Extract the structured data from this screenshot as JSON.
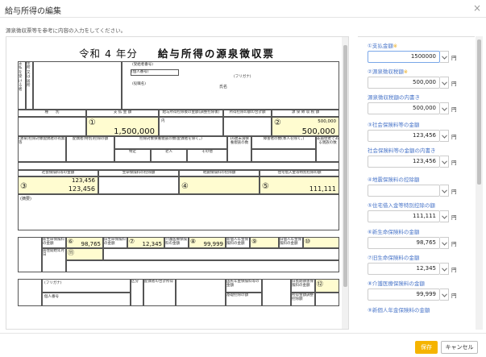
{
  "dialog": {
    "title": "給与所得の編集",
    "instruction": "源泉徴収票等を参考に内容の入力をしてください。"
  },
  "form": {
    "year_label": "令和 4 年分",
    "title": "給与所得の源泉徴収票",
    "labels": {
      "payer_recipient": "支払を受ける者",
      "address": "住所又は居所",
      "recipient_no": "(受給者番号)",
      "personal_no": "(個人番号)",
      "position": "(役職名)",
      "furigana": "(フリガナ)",
      "name": "氏名",
      "type": "種　　別",
      "payment_amount": "支 払 金 額",
      "post_deduction": "給与所得控除後の金額(調整控除後)",
      "deduction_total": "所得控除の額の合計額",
      "withholding_tax": "源 泉 徴 収 税 額",
      "inner": "内",
      "spouse": "(源泉)控除対象配偶者の有無等",
      "spouse_special": "配偶者(特別)控除の額",
      "dependents": "控除対象扶養親族の数(配偶者を除く。)",
      "specific": "特定",
      "elderly": "老人",
      "other": "その他",
      "minor": "16歳未満扶養親族の数",
      "disabled": "障害者の数(本人を除く。)",
      "non_resident": "非居住者である親族の数",
      "yen": "円",
      "people": "人",
      "social_ins": "社会保険料等の金額",
      "life_ins": "生命保険料の控除額",
      "earthquake_ins": "地震保険料の控除額",
      "housing_loan": "住宅借入金等特別控除の額",
      "remarks": "(摘要)",
      "new_life": "新生命保険料の金額",
      "old_life": "旧生命保険料の金額",
      "care_ins": "介護医療保険料の金額",
      "new_pension": "新個人年金保険料の金額",
      "old_pension": "旧個人年金保険料の金額",
      "housing_date": "居住開始年月日",
      "spouse_name": "(フリガナ) 氏名",
      "individual_no": "個人番号",
      "national_pension": "国民年金保険料等の金額",
      "spouse_income": "配偶者の合計所得",
      "old_long_ins": "旧長期損害保険料の金額",
      "basic_adjust": "基礎控除の額",
      "income_adjust": "所得金額調整控除額",
      "category": "区分",
      "ruby": "(フリガナ)"
    },
    "badges": {
      "b1": "①",
      "b2": "②",
      "b3": "③",
      "b4": "④",
      "b5": "⑤",
      "b6": "⑥",
      "b7": "⑦",
      "b8": "⑧",
      "b9": "⑨",
      "b10": "⑩",
      "b11": "⑪",
      "b12": "⑫"
    },
    "values": {
      "payment": "1,500,000",
      "withholding_ref": "500,000",
      "withholding": "500,000",
      "social_ins_ref": "123,456",
      "social_ins": "123,456",
      "housing_loan": "111,111",
      "new_life": "98,765",
      "old_life": "12,345",
      "care_ins": "99,999"
    }
  },
  "panel": {
    "fields": [
      {
        "label": "①支払金額",
        "required": "※",
        "value": "1500000",
        "unit": "円",
        "focus": true
      },
      {
        "label": "②源泉徴収税額",
        "required": "※",
        "value": "500,000",
        "unit": "円"
      },
      {
        "label": "源泉徴収税額の内書き",
        "required": "",
        "value": "500,000",
        "unit": "円"
      },
      {
        "label": "③社会保険料等の金額",
        "required": "",
        "value": "123,456",
        "unit": "円"
      },
      {
        "label": "社会保険料等の金額の内書き",
        "required": "",
        "value": "123,456",
        "unit": "円"
      },
      {
        "label": "④地震保険料の控除額",
        "required": "",
        "value": "",
        "unit": "円"
      },
      {
        "label": "⑤住宅借入金等特別控除の額",
        "required": "",
        "value": "111,111",
        "unit": "円"
      },
      {
        "label": "⑥新生命保険料の金額",
        "required": "",
        "value": "98,765",
        "unit": "円"
      },
      {
        "label": "⑦旧生命保険料の金額",
        "required": "",
        "value": "12,345",
        "unit": "円"
      },
      {
        "label": "⑧介護医療保険料の金額",
        "required": "",
        "value": "99,999",
        "unit": "円"
      },
      {
        "label": "⑨新個人年金保険料の金額",
        "required": "",
        "value": "",
        "unit": ""
      }
    ]
  },
  "footer": {
    "save_label": "保存",
    "cancel_label": "キャンセル"
  },
  "colors": {
    "save_button": "#f5b400",
    "label_blue": "#4a76c9",
    "required_mark": "#e8a40a",
    "highlight": "#fffcd0"
  }
}
